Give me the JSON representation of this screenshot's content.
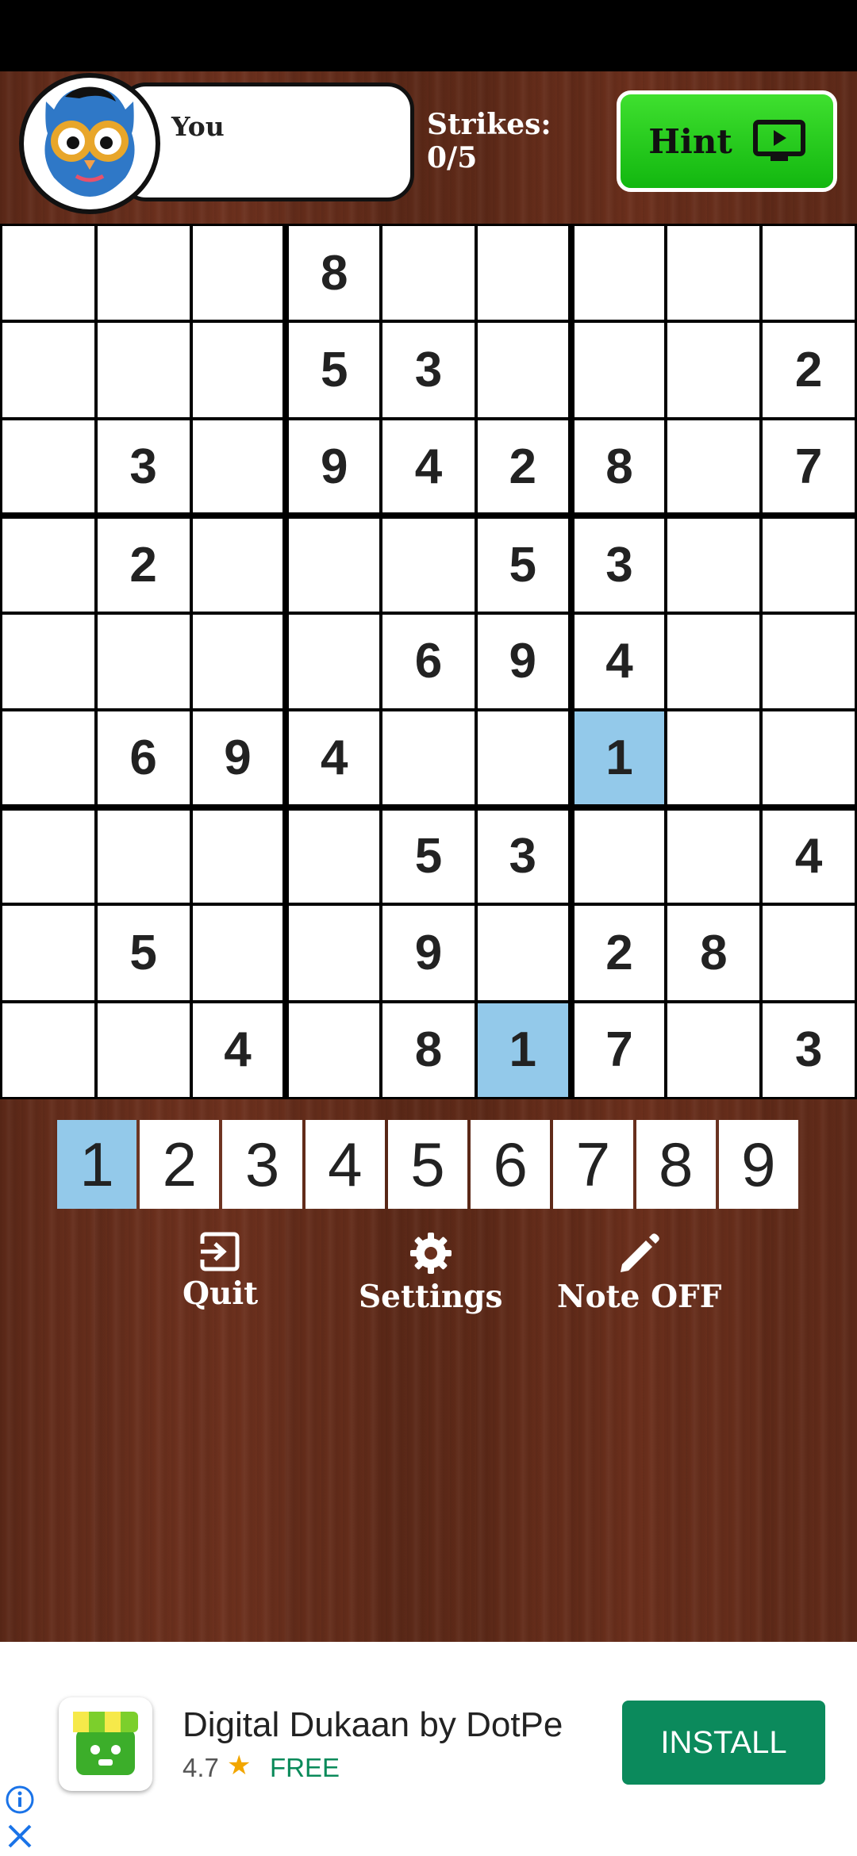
{
  "player": {
    "name": "You"
  },
  "strikes": {
    "label": "Strikes:",
    "value": "0/5"
  },
  "hint": {
    "label": "Hint",
    "icon": "play-video-icon"
  },
  "board": {
    "rows": [
      [
        "",
        "",
        "",
        "8",
        "",
        "",
        "",
        "",
        ""
      ],
      [
        "",
        "",
        "",
        "5",
        "3",
        "",
        "",
        "",
        "2"
      ],
      [
        "",
        "3",
        "",
        "9",
        "4",
        "2",
        "8",
        "",
        "7"
      ],
      [
        "",
        "2",
        "",
        "",
        "",
        "5",
        "3",
        "",
        ""
      ],
      [
        "",
        "",
        "",
        "",
        "6",
        "9",
        "4",
        "",
        ""
      ],
      [
        "",
        "6",
        "9",
        "4",
        "",
        "",
        "1",
        "",
        ""
      ],
      [
        "",
        "",
        "",
        "",
        "5",
        "3",
        "",
        "",
        "4"
      ],
      [
        "",
        "5",
        "",
        "",
        "9",
        "",
        "2",
        "8",
        ""
      ],
      [
        "",
        "",
        "4",
        "",
        "8",
        "1",
        "7",
        "",
        "3"
      ]
    ],
    "highlighted": [
      [
        5,
        6
      ],
      [
        8,
        5
      ]
    ],
    "highlight_color": "#93c9ea"
  },
  "numpad": {
    "numbers": [
      "1",
      "2",
      "3",
      "4",
      "5",
      "6",
      "7",
      "8",
      "9"
    ],
    "selected": "1"
  },
  "controls": {
    "quit": {
      "label": "Quit",
      "icon": "exit-icon"
    },
    "settings": {
      "label": "Settings",
      "icon": "gear-icon"
    },
    "note": {
      "label": "Note OFF",
      "icon": "pencil-icon"
    }
  },
  "ad": {
    "title": "Digital Dukaan by DotPe",
    "rating": "4.7",
    "price": "FREE",
    "install_label": "INSTALL",
    "accent": "#0b8a5c"
  }
}
